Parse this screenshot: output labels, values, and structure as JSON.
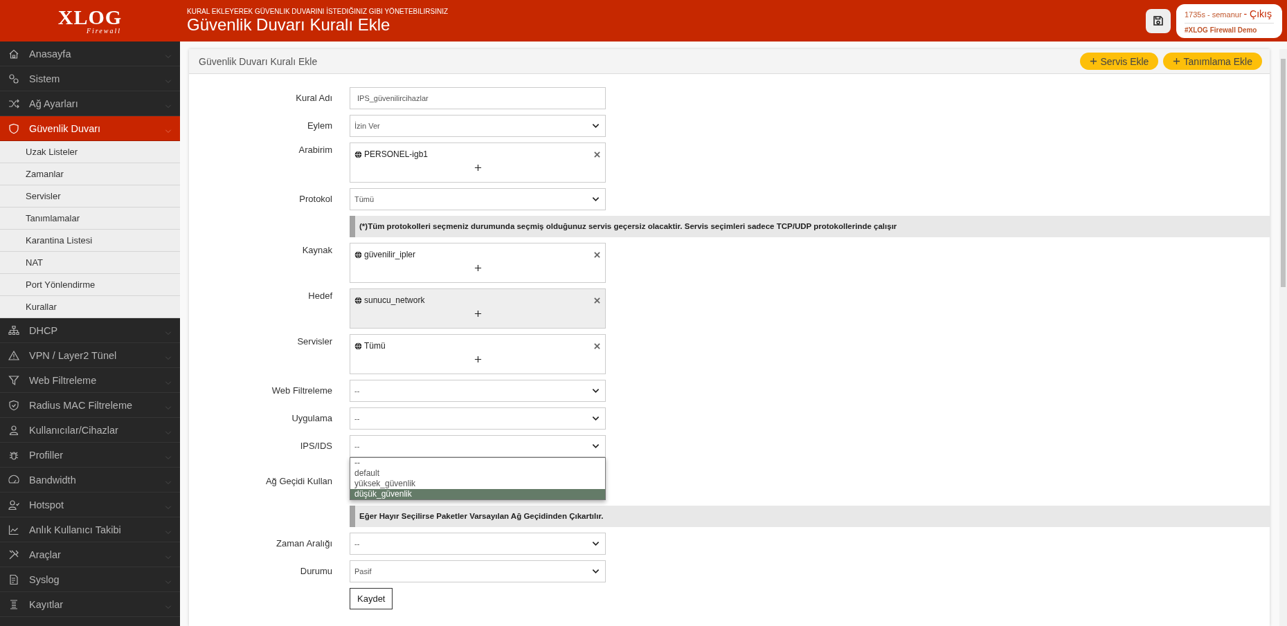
{
  "brand": {
    "logo": "XLOG",
    "tagline": "Firewall"
  },
  "sidebar": {
    "items": [
      {
        "label": "Anasayfa",
        "selected": false
      },
      {
        "label": "Sistem",
        "selected": false
      },
      {
        "label": "Ağ Ayarları",
        "selected": false
      },
      {
        "label": "Güvenlik Duvarı",
        "selected": true,
        "children": [
          {
            "label": "Uzak Listeler",
            "selected": false
          },
          {
            "label": "Zamanlar",
            "selected": false
          },
          {
            "label": "Servisler",
            "selected": false
          },
          {
            "label": "Tanımlamalar",
            "selected": false
          },
          {
            "label": "Karantina Listesi",
            "selected": false
          },
          {
            "label": "NAT",
            "selected": false
          },
          {
            "label": "Port Yönlendirme",
            "selected": false
          },
          {
            "label": "Kurallar",
            "selected": false
          }
        ]
      },
      {
        "label": "DHCP",
        "selected": false
      },
      {
        "label": "VPN / Layer2 Tünel",
        "selected": false
      },
      {
        "label": "Web Filtreleme",
        "selected": false
      },
      {
        "label": "Radius MAC Filtreleme",
        "selected": false
      },
      {
        "label": "Kullanıcılar/Cihazlar",
        "selected": false
      },
      {
        "label": "Profiller",
        "selected": false
      },
      {
        "label": "Bandwidth",
        "selected": false
      },
      {
        "label": "Hotspot",
        "selected": false
      },
      {
        "label": "Anlık Kullanıcı Takibi",
        "selected": false
      },
      {
        "label": "Araçlar",
        "selected": false
      },
      {
        "label": "Syslog",
        "selected": false
      },
      {
        "label": "Kayıtlar",
        "selected": false
      }
    ]
  },
  "header": {
    "subtitle": "KURAL EKLEYEREK GÜVENLIK DUVARINI İSTEDIĞINIZ GIBI YÖNETEBILIRSINIZ",
    "title": "Güvenlik Duvarı Kuralı Ekle",
    "user": {
      "session": "1735s - semanur",
      "logout": "- Çıkış",
      "device": "#XLOG Firewall Demo"
    }
  },
  "panel": {
    "title": "Güvenlik Duvarı Kuralı Ekle",
    "buttons": [
      "Servis Ekle",
      "Tanımlama Ekle"
    ]
  },
  "form": {
    "rows": [
      {
        "kind": "text",
        "label": "Kural Adı",
        "value": "IPS_güvenilircihazlar"
      },
      {
        "kind": "select",
        "label": "Eylem",
        "value": "İzin Ver"
      },
      {
        "kind": "tags",
        "label": "Arabirim",
        "disabled": false,
        "tags": [
          "PERSONEL-igb1"
        ]
      },
      {
        "kind": "select",
        "label": "Protokol",
        "value": "Tümü"
      },
      {
        "kind": "note",
        "text": "(*)Tüm protokolleri seçmeniz durumunda seçmiş olduğunuz servis geçersiz olacaktir. Servis seçimleri sadece TCP/UDP protokollerinde çalışır"
      },
      {
        "kind": "tags",
        "label": "Kaynak",
        "disabled": false,
        "tags": [
          "güvenilir_ipler"
        ]
      },
      {
        "kind": "tags",
        "label": "Hedef",
        "disabled": true,
        "tags": [
          "sunucu_network"
        ]
      },
      {
        "kind": "tags",
        "label": "Servisler",
        "disabled": false,
        "tags": [
          "Tümü"
        ]
      },
      {
        "kind": "select",
        "label": "Web Filtreleme",
        "value": "--"
      },
      {
        "kind": "select",
        "label": "Uygulama",
        "value": "--"
      },
      {
        "kind": "select",
        "label": "IPS/IDS",
        "value": "--",
        "open": true,
        "options": [
          {
            "label": "--",
            "highlighted": false
          },
          {
            "label": "default",
            "highlighted": false
          },
          {
            "label": "yüksek_güvenlik",
            "highlighted": false
          },
          {
            "label": "düşük_güvenlik",
            "highlighted": true
          }
        ]
      },
      {
        "kind": "covered",
        "label": "Ağ Geçidi Kullan"
      },
      {
        "kind": "note",
        "text": "Eğer Hayır Seçilirse Paketler Varsayılan Ağ Geçidinden Çıkartılır."
      },
      {
        "kind": "select",
        "label": "Zaman Aralığı",
        "value": "--"
      },
      {
        "kind": "select",
        "label": "Durumu",
        "value": "Pasif"
      }
    ],
    "submit": "Kaydet"
  }
}
